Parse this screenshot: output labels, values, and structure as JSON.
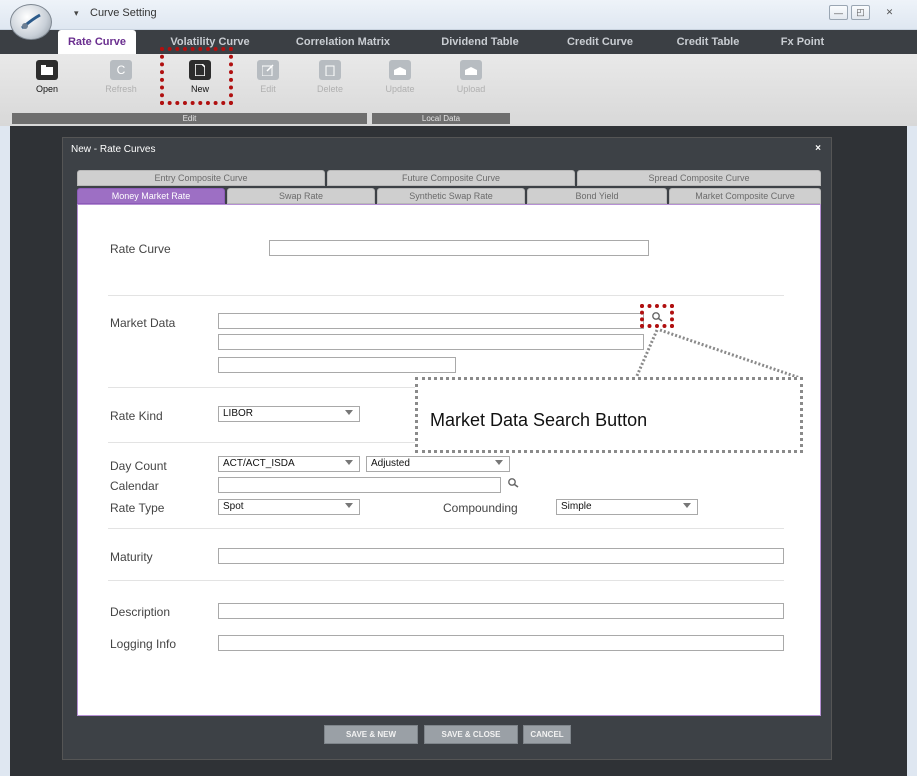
{
  "window": {
    "title": "Curve Setting",
    "quick_access_glyph": "▾",
    "minimize_glyph": "—",
    "restore_glyph": "◰",
    "close_glyph": "✕"
  },
  "ribbon_tabs": [
    {
      "label": "Rate Curve",
      "active": true
    },
    {
      "label": "Volatility Curve"
    },
    {
      "label": "Correlation Matrix"
    },
    {
      "label": "Dividend Table"
    },
    {
      "label": "Credit Curve"
    },
    {
      "label": "Credit Table"
    },
    {
      "label": "Fx Point"
    }
  ],
  "ribbon_buttons": {
    "open": {
      "label": "Open",
      "icon": "folder-icon"
    },
    "refresh": {
      "label": "Refresh",
      "icon": "refresh-icon"
    },
    "new": {
      "label": "New",
      "icon": "new-document-icon"
    },
    "edit": {
      "label": "Edit",
      "icon": "edit-icon"
    },
    "delete": {
      "label": "Delete",
      "icon": "delete-icon"
    },
    "update": {
      "label": "Update",
      "icon": "update-icon"
    },
    "upload": {
      "label": "Upload",
      "icon": "upload-icon"
    }
  },
  "ribbon_groups": {
    "edit": "Edit",
    "local_data": "Local Data"
  },
  "dialog": {
    "title": "New - Rate Curves",
    "close_glyph": "×",
    "tabs_row1": [
      "Entry Composite Curve",
      "Future Composite Curve",
      "Spread Composite Curve"
    ],
    "tabs_row2": [
      "Money Market Rate",
      "Swap Rate",
      "Synthetic Swap Rate",
      "Bond Yield",
      "Market Composite Curve"
    ],
    "active_tab": "Money Market Rate"
  },
  "form": {
    "rate_curve": {
      "label": "Rate Curve",
      "value": ""
    },
    "market_data": {
      "label": "Market Data",
      "value": "",
      "value2": "",
      "value3": ""
    },
    "rate_kind": {
      "label": "Rate Kind",
      "value": "LIBOR"
    },
    "day_count": {
      "label": "Day Count",
      "value": "ACT/ACT_ISDA",
      "adjust": "Adjusted"
    },
    "calendar": {
      "label": "Calendar",
      "value": ""
    },
    "rate_type": {
      "label": "Rate Type",
      "value": "Spot"
    },
    "compounding": {
      "label": "Compounding",
      "value": "Simple"
    },
    "maturity": {
      "label": "Maturity",
      "value": ""
    },
    "description": {
      "label": "Description",
      "value": ""
    },
    "logging_info": {
      "label": "Logging Info",
      "value": ""
    }
  },
  "buttons": {
    "save_new": "SAVE & NEW",
    "save_close": "SAVE & CLOSE",
    "cancel": "CANCEL"
  },
  "annotation": {
    "callout": "Market Data Search Button",
    "highlight_color": "#b01010"
  }
}
